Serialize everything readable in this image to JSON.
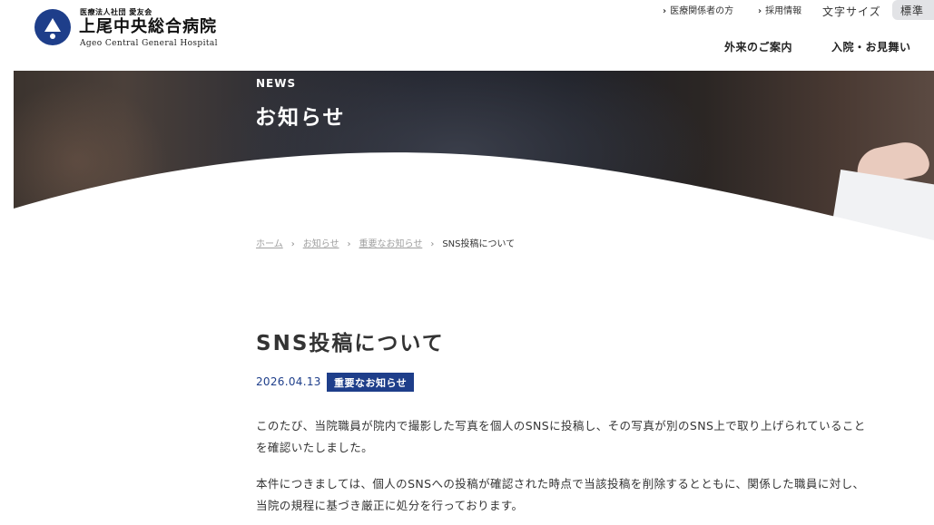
{
  "header": {
    "logo_corp": "医療法人社団 愛友会",
    "logo_name": "上尾中央総合病院",
    "logo_en": "Ageo Central General Hospital",
    "util_links": [
      "医療関係者の方",
      "採用情報"
    ],
    "fontsize_label": "文字サイズ",
    "fontsize_current": "標準",
    "gnav": [
      "外来のご案内",
      "入院・お見舞い"
    ]
  },
  "hero": {
    "label": "NEWS",
    "title": "お知らせ"
  },
  "breadcrumb": {
    "items": [
      "ホーム",
      "お知らせ",
      "重要なお知らせ"
    ],
    "current": "SNS投稿について",
    "separator": "›"
  },
  "article": {
    "title": "SNS投稿について",
    "date": "2026.04.13",
    "category": "重要なお知らせ",
    "paragraphs": [
      "このたび、当院職員が院内で撮影した写真を個人のSNSに投稿し、その写真が別のSNS上で取り上げられていることを確認いたしました。",
      "本件につきましては、個人のSNSへの投稿が確認された時点で当該投稿を削除するとともに、関係した職員に対し、当院の規程に基づき厳正に処分を行っております。"
    ]
  },
  "colors": {
    "brand": "#1e3e8a",
    "text": "#333333",
    "muted": "#9a9a9a"
  },
  "icons": [
    "hospital-logo-icon",
    "chevron-right-icon"
  ]
}
